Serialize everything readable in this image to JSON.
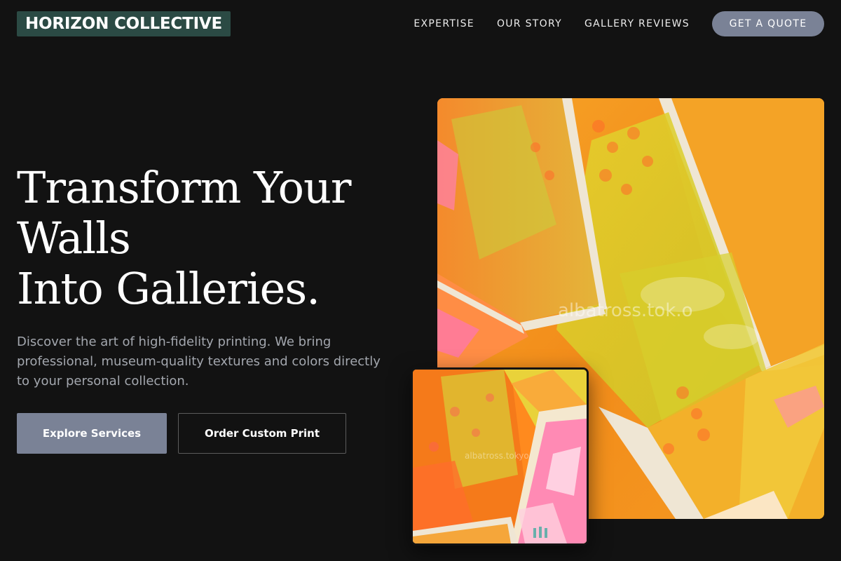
{
  "header": {
    "logo": "HORIZON COLLECTIVE",
    "nav": [
      {
        "label": "EXPERTISE"
      },
      {
        "label": "OUR STORY"
      },
      {
        "label": "GALLERY REVIEWS"
      }
    ],
    "cta_label": "GET A QUOTE"
  },
  "hero": {
    "title_lines": [
      "Transform Your",
      "Walls",
      "Into Galleries."
    ],
    "description": "Discover the art of high-fidelity printing. We bring professional, museum-quality textures and colors directly to your personal collection.",
    "primary_button": "Explore Services",
    "secondary_button": "Order Custom Print"
  },
  "gallery": {
    "main_watermark": "albatross.tok.o",
    "inset_watermark": "albatross.tokyo"
  },
  "colors": {
    "background": "#121212",
    "logo_background": "#2b4a44",
    "accent_button": "#7a8296",
    "art_orange": "#f6a020",
    "art_yellow": "#d6d22a",
    "art_pink": "#ff6fa0"
  }
}
